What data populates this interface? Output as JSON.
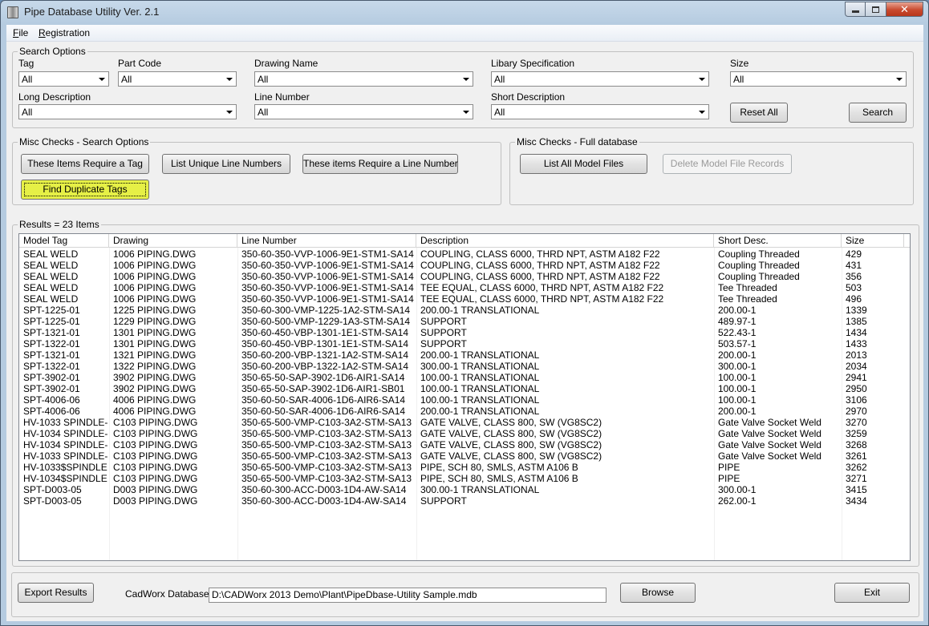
{
  "window": {
    "title": "Pipe Database Utility Ver. 2.1"
  },
  "menu": [
    {
      "underline": "F",
      "rest": "ile"
    },
    {
      "underline": "R",
      "rest": "egistration"
    }
  ],
  "search_options": {
    "title": "Search Options",
    "fields": {
      "tag": {
        "label": "Tag",
        "value": "All"
      },
      "part_code": {
        "label": "Part Code",
        "value": "All"
      },
      "drawing_name": {
        "label": "Drawing Name",
        "value": "All"
      },
      "library_spec": {
        "label": "Libary Specification",
        "value": "All"
      },
      "size": {
        "label": "Size",
        "value": "All"
      },
      "long_description": {
        "label": "Long Description",
        "value": "All"
      },
      "line_number": {
        "label": "Line Number",
        "value": "All"
      },
      "short_description": {
        "label": "Short Description",
        "value": "All"
      }
    },
    "reset_label": "Reset All",
    "search_label": "Search"
  },
  "misc_search": {
    "title": "Misc Checks - Search Options",
    "require_tag": "These Items Require a Tag",
    "unique_lines": "List Unique Line Numbers",
    "require_line": "These items Require a Line Number",
    "find_duplicates": "Find Duplicate Tags"
  },
  "misc_full": {
    "title": "Misc Checks - Full database",
    "list_model": "List All Model Files",
    "delete_model": "Delete Model File Records"
  },
  "results": {
    "title": "Results = 23 Items",
    "columns": [
      "Model Tag",
      "Drawing",
      "Line Number",
      "Description",
      "Short Desc.",
      "Size"
    ],
    "rows": [
      [
        "SEAL WELD",
        "1006 PIPING.DWG",
        "350-60-350-VVP-1006-9E1-STM1-SA14",
        "COUPLING, CLASS 6000, THRD NPT, ASTM A182 F22",
        "Coupling Threaded",
        "429"
      ],
      [
        "SEAL WELD",
        "1006 PIPING.DWG",
        "350-60-350-VVP-1006-9E1-STM1-SA14",
        "COUPLING, CLASS 6000, THRD NPT, ASTM A182 F22",
        "Coupling Threaded",
        "431"
      ],
      [
        "SEAL WELD",
        "1006 PIPING.DWG",
        "350-60-350-VVP-1006-9E1-STM1-SA14",
        "COUPLING, CLASS 6000, THRD NPT, ASTM A182 F22",
        "Coupling Threaded",
        "356"
      ],
      [
        "SEAL WELD",
        "1006 PIPING.DWG",
        "350-60-350-VVP-1006-9E1-STM1-SA14",
        "TEE EQUAL, CLASS 6000, THRD NPT, ASTM A182 F22",
        "Tee Threaded",
        "503"
      ],
      [
        "SEAL WELD",
        "1006 PIPING.DWG",
        "350-60-350-VVP-1006-9E1-STM1-SA14",
        "TEE EQUAL, CLASS 6000, THRD NPT, ASTM A182 F22",
        "Tee Threaded",
        "496"
      ],
      [
        "SPT-1225-01",
        "1225 PIPING.DWG",
        "350-60-300-VMP-1225-1A2-STM-SA14",
        "200.00-1 TRANSLATIONAL",
        "200.00-1",
        "1339"
      ],
      [
        "SPT-1225-01",
        "1229 PIPING.DWG",
        "350-60-500-VMP-1229-1A3-STM-SA14",
        "SUPPORT",
        "489.97-1",
        "1385"
      ],
      [
        "SPT-1321-01",
        "1301 PIPING.DWG",
        "350-60-450-VBP-1301-1E1-STM-SA14",
        "SUPPORT",
        "522.43-1",
        "1434"
      ],
      [
        "SPT-1322-01",
        "1301 PIPING.DWG",
        "350-60-450-VBP-1301-1E1-STM-SA14",
        "SUPPORT",
        "503.57-1",
        "1433"
      ],
      [
        "SPT-1321-01",
        "1321 PIPING.DWG",
        "350-60-200-VBP-1321-1A2-STM-SA14",
        "200.00-1 TRANSLATIONAL",
        "200.00-1",
        "2013"
      ],
      [
        "SPT-1322-01",
        "1322 PIPING.DWG",
        "350-60-200-VBP-1322-1A2-STM-SA14",
        "300.00-1 TRANSLATIONAL",
        "300.00-1",
        "2034"
      ],
      [
        "SPT-3902-01",
        "3902 PIPING.DWG",
        "350-65-50-SAP-3902-1D6-AIR1-SA14",
        "100.00-1 TRANSLATIONAL",
        "100.00-1",
        "2941"
      ],
      [
        "SPT-3902-01",
        "3902 PIPING.DWG",
        "350-65-50-SAP-3902-1D6-AIR1-SB01",
        "100.00-1 TRANSLATIONAL",
        "100.00-1",
        "2950"
      ],
      [
        "SPT-4006-06",
        "4006 PIPING.DWG",
        "350-60-50-SAR-4006-1D6-AIR6-SA14",
        "100.00-1 TRANSLATIONAL",
        "100.00-1",
        "3106"
      ],
      [
        "SPT-4006-06",
        "4006 PIPING.DWG",
        "350-60-50-SAR-4006-1D6-AIR6-SA14",
        "200.00-1 TRANSLATIONAL",
        "200.00-1",
        "2970"
      ],
      [
        "HV-1033 SPINDLE-...",
        "C103 PIPING.DWG",
        "350-65-500-VMP-C103-3A2-STM-SA13",
        "GATE VALVE, CLASS 800, SW (VG8SC2)",
        "Gate Valve Socket Weld",
        "3270"
      ],
      [
        "HV-1034 SPINDLE-...",
        "C103 PIPING.DWG",
        "350-65-500-VMP-C103-3A2-STM-SA13",
        "GATE VALVE, CLASS 800, SW (VG8SC2)",
        "Gate Valve Socket Weld",
        "3259"
      ],
      [
        "HV-1034 SPINDLE-...",
        "C103 PIPING.DWG",
        "350-65-500-VMP-C103-3A2-STM-SA13",
        "GATE VALVE, CLASS 800, SW (VG8SC2)",
        "Gate Valve Socket Weld",
        "3268"
      ],
      [
        "HV-1033 SPINDLE-...",
        "C103 PIPING.DWG",
        "350-65-500-VMP-C103-3A2-STM-SA13",
        "GATE VALVE, CLASS 800, SW (VG8SC2)",
        "Gate Valve Socket Weld",
        "3261"
      ],
      [
        "HV-1033$SPINDLE...",
        "C103 PIPING.DWG",
        "350-65-500-VMP-C103-3A2-STM-SA13",
        "PIPE, SCH 80, SMLS, ASTM A106 B",
        "PIPE",
        "3262"
      ],
      [
        "HV-1034$SPINDLE...",
        "C103 PIPING.DWG",
        "350-65-500-VMP-C103-3A2-STM-SA13",
        "PIPE, SCH 80, SMLS, ASTM A106 B",
        "PIPE",
        "3271"
      ],
      [
        "SPT-D003-05",
        "D003 PIPING.DWG",
        "350-60-300-ACC-D003-1D4-AW-SA14",
        "300.00-1 TRANSLATIONAL",
        "300.00-1",
        "3415"
      ],
      [
        "SPT-D003-05",
        "D003 PIPING.DWG",
        "350-60-300-ACC-D003-1D4-AW-SA14",
        "SUPPORT",
        "262.00-1",
        "3434"
      ]
    ]
  },
  "footer": {
    "export_label": "Export Results",
    "db_label": "CadWorx Database:",
    "db_path": "D:\\CADWorx 2013 Demo\\Plant\\PipeDbase-Utility Sample.mdb",
    "browse_label": "Browse",
    "exit_label": "Exit"
  },
  "colors": {
    "highlight_button": "#e6f046",
    "window_frame": "#b5cbe0",
    "close_button": "#c94a2f"
  },
  "icons": {
    "app": "app-icon",
    "combo_arrow": "chevron-down-icon"
  }
}
